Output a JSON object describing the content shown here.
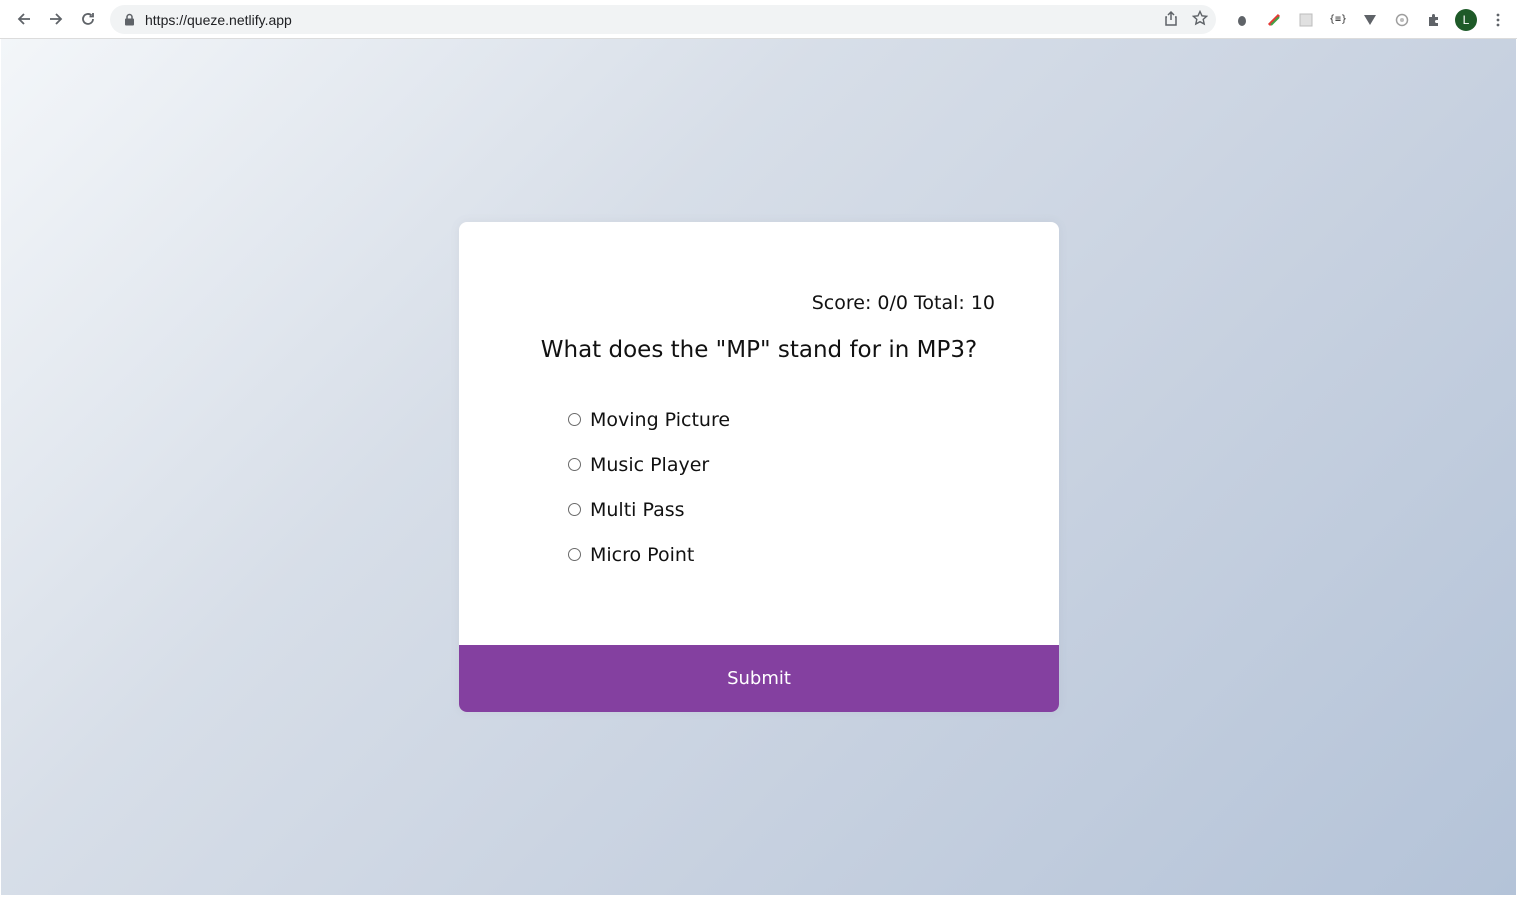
{
  "browser": {
    "url": "https://queze.netlify.app",
    "profile_initial": "L",
    "extension_label": "{≡}"
  },
  "quiz": {
    "score_text": "Score: 0/0 Total: 10",
    "question": "What does the \"MP\" stand for in MP3?",
    "answers": [
      {
        "label": "Moving Picture"
      },
      {
        "label": "Music Player"
      },
      {
        "label": "Multi Pass"
      },
      {
        "label": "Micro Point"
      }
    ],
    "submit_label": "Submit"
  },
  "colors": {
    "submit_bg": "#8440a0",
    "card_bg": "#ffffff"
  }
}
